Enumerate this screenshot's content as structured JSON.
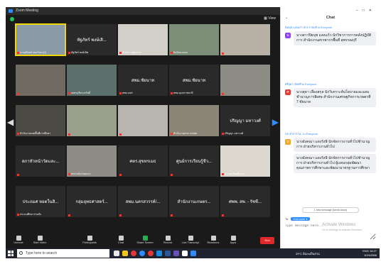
{
  "window": {
    "title": "Zoom Meeting"
  },
  "topbar": {
    "view_label": "View"
  },
  "gallery": {
    "tiles": [
      {
        "label": "นายสุรินทร์ ทองโยธา(1)",
        "name_top": "",
        "color": "#8a9aa6",
        "highlight": true
      },
      {
        "label": "หัฐภัทร์ พงษ์เลิศ",
        "name_top": "หัฐภัทร์ พงษ์เสิ...",
        "color": "#2a2a2a",
        "highlight": false
      },
      {
        "label": "สำนักงานผู้ตรวจ...",
        "name_top": "",
        "color": "#d2cfc8",
        "highlight": false
      },
      {
        "label": "ปัจจัยนากมภ.",
        "name_top": "",
        "color": "#7d8e78",
        "highlight": false
      },
      {
        "label": "",
        "name_top": "",
        "color": "#b7b0a4",
        "highlight": false
      },
      {
        "label": "",
        "name_top": "",
        "color": "#6f6a62",
        "highlight": false
      },
      {
        "label": "เพชรบุรีสระสวัสดิ์",
        "name_top": "",
        "color": "#5d6f6a",
        "highlight": false
      },
      {
        "label": "สพม.แพร่",
        "name_top": "สพม.ชัยนาท",
        "color": "#2a2a2a",
        "highlight": false
      },
      {
        "label": "สพม.อุบลราชธานี",
        "name_top": "สพม.ชัยนาท",
        "color": "#2a2a2a",
        "highlight": false
      },
      {
        "label": "",
        "name_top": "",
        "color": "#8d8c84",
        "highlight": false
      },
      {
        "label": "สำนักงานเขตพื้นที่การศึกษา",
        "name_top": "",
        "color": "#4b4a45",
        "highlight": false
      },
      {
        "label": "",
        "name_top": "",
        "color": "#9aa08b",
        "highlight": false
      },
      {
        "label": "",
        "name_top": "",
        "color": "#b7b5ad",
        "highlight": false
      },
      {
        "label": "สำนักงานสาธารณสุข",
        "name_top": "",
        "color": "#8a8576",
        "highlight": false
      },
      {
        "label": "ปริญญา มหาวงศ์",
        "name_top": "ปริญญา มหาวงศ์",
        "color": "#2a2a2a",
        "highlight": false
      },
      {
        "label": "",
        "name_top": "สภาหัวหน้าวัดและ...",
        "color": "#2a2a2a",
        "highlight": false
      },
      {
        "label": "สหกรณ์ภาคผนวก",
        "name_top": "",
        "color": "#8f8c86",
        "highlight": false
      },
      {
        "label": "",
        "name_top": "ศตร.สุขทรเมธ",
        "color": "#2a2a2a",
        "highlight": false
      },
      {
        "label": "",
        "name_top": "ศูนย์การเรียนรู้ชีว...",
        "color": "#2a2a2a",
        "highlight": false
      },
      {
        "label": "สมาคมวิทยุสื่อสาร",
        "name_top": "",
        "color": "#dcd8cf",
        "highlight": false
      },
      {
        "label": "ประถมศึกษาร่วมกัน",
        "name_top": "ประถมศ หอดในสิ...",
        "color": "#2a2a2a",
        "highlight": false
      },
      {
        "label": "",
        "name_top": "กลุ่มยุทธศาสตร์...",
        "color": "#2a2a2a",
        "highlight": false
      },
      {
        "label": "",
        "name_top": "สพม.นครสวรรค์/...",
        "color": "#2a2a2a",
        "highlight": false
      },
      {
        "label": "",
        "name_top": "สำนักงานเกษตร...",
        "color": "#2a2a2a",
        "highlight": false
      },
      {
        "label": "",
        "name_top": "ศพพ. สพ. - รัชชี...",
        "color": "#2a2a2a",
        "highlight": false
      }
    ]
  },
  "controls": {
    "unmute": "Unmute",
    "start_video": "Start Video",
    "participants": "Participants",
    "participants_count": "133",
    "chat": "Chat",
    "share_screen": "Share Screen",
    "record": "Record",
    "live_transcript": "Live Transcript",
    "reactions": "Reactions",
    "apps": "Apps",
    "end": "End"
  },
  "chat": {
    "title": "Chat",
    "messages": [
      {
        "sender": "นิดนุช แสงแก้ว สกร.ราชบุรี to Everyone",
        "avatar": "น",
        "avatar_color": "#8e44ff",
        "bubbles": [
          "นางสาวปิยนุช แสงแก้ว นักวิชาการการคลังปฏิบัติการ สำนักงานสรรพากรพื้นที่ สุพรรณบุรี"
        ]
      },
      {
        "sender": "ศรีสุดา เกิดศรี to Everyone",
        "avatar": "ศ",
        "avatar_color": "#e53935",
        "bubbles": [
          "นางสุดา เลื่องสกุล นักวิเคราะห์นโยบายและแผนชำนาญการพิเศษ สำนักงานเศรษฐกิจการเกษตรที่ 7 ชัยนาท"
        ]
      },
      {
        "sender": "ประจำการวัน - to Everyone",
        "avatar": "ป",
        "avatar_color": "#f5a623",
        "bubbles": [
          "นางอังคณา แดงรังษี นักจัดการงานทั่วไปชำนาญการ ฝ่ายบริหารงานทั่วไป",
          "นางอังคณา แดงรังษี นักจัดการงานทั่วไปชำนาญการ ฝ่ายบริหารงานทั่วไป ผู้แทนกลุ่มพัฒนาคุณภาพการศึกษาและพัฒนามาตรฐานการศึกษา"
        ]
      }
    ],
    "more_messages": "1 new message (scroll down)",
    "to_label": "To:",
    "to_target": "Everyone",
    "input_placeholder": "Type message here...",
    "activate_title": "Activate Windows",
    "activate_sub": "Go to Settings to activate Windows."
  },
  "taskbar": {
    "search_placeholder": "Type here to search",
    "weather": "29°C มีเมฆเป็นส่วน",
    "language": "ENG",
    "time": "16:27",
    "date": "10/4/2566"
  }
}
